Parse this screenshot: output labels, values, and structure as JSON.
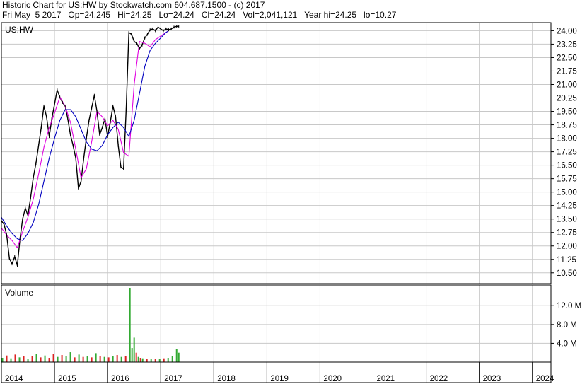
{
  "header": {
    "line1": "Historic Chart for US:HW by Stockwatch.com 604.687.1500 - (c) 2017",
    "line2": "Fri May  5 2017   Op=24.245   Hi=24.25   Lo=24.24   Cl=24.24   Vol=2,041,121   Year hi=24.25   lo=10.27"
  },
  "colors": {
    "price": "#000000",
    "ma_short": "#e000e0",
    "ma_long": "#0000c0",
    "vol_up": "#33aa33",
    "vol_down": "#dd2222",
    "grid": "#c8c8c8",
    "frame": "#000000"
  },
  "chart_data": [
    {
      "type": "line",
      "ticker_label": "US:HW",
      "ylim": [
        9.9,
        24.45
      ],
      "y_ticks": [
        "24.00",
        "23.25",
        "22.50",
        "21.75",
        "21.00",
        "20.25",
        "19.50",
        "18.75",
        "18.00",
        "17.25",
        "16.50",
        "15.75",
        "15.00",
        "14.25",
        "13.50",
        "12.75",
        "12.00",
        "11.25",
        "10.50"
      ],
      "y_tick_values": [
        24.0,
        23.25,
        22.5,
        21.75,
        21.0,
        20.25,
        19.5,
        18.75,
        18.0,
        17.25,
        16.5,
        15.75,
        15.0,
        14.25,
        13.5,
        12.75,
        12.0,
        11.25,
        10.5
      ],
      "x_ticks": [
        "2014",
        "2015",
        "2016",
        "2017",
        "2018",
        "2019",
        "2020",
        "2021",
        "2022",
        "2023",
        "2024"
      ],
      "x_tick_values": [
        2014.0,
        2015.0,
        2016.0,
        2017.0,
        2018.0,
        2019.0,
        2020.0,
        2021.0,
        2022.0,
        2023.0,
        2024.0
      ],
      "xlim": [
        2014.0,
        2024.35
      ],
      "grid": true,
      "series": [
        {
          "x": [
            2014.0,
            2014.05,
            2014.1,
            2014.15,
            2014.2,
            2014.25,
            2014.3,
            2014.35,
            2014.4,
            2014.45,
            2014.5,
            2014.55,
            2014.6,
            2014.65,
            2014.7,
            2014.75,
            2014.8,
            2014.85,
            2014.9,
            2014.95,
            2015.0,
            2015.05,
            2015.1,
            2015.15,
            2015.2,
            2015.25,
            2015.3,
            2015.35,
            2015.4,
            2015.45,
            2015.5,
            2015.55,
            2015.6,
            2015.65,
            2015.7,
            2015.75,
            2015.8,
            2015.85,
            2015.9,
            2015.95,
            2016.0,
            2016.05,
            2016.1,
            2016.15,
            2016.2,
            2016.25,
            2016.3,
            2016.35,
            2016.4,
            2016.45,
            2016.5,
            2016.55,
            2016.6,
            2016.65,
            2016.7,
            2016.75,
            2016.8,
            2016.85,
            2016.9,
            2016.95,
            2017.0,
            2017.05,
            2017.1,
            2017.15,
            2017.2,
            2017.25,
            2017.3,
            2017.34
          ],
          "values": [
            13.4,
            13.2,
            12.6,
            11.3,
            11.0,
            11.4,
            10.9,
            12.4,
            13.5,
            14.1,
            13.7,
            14.7,
            15.8,
            16.6,
            17.6,
            18.6,
            19.8,
            19.2,
            18.1,
            19.1,
            19.9,
            20.7,
            20.3,
            20.0,
            19.8,
            19.1,
            18.2,
            17.6,
            16.9,
            15.2,
            15.6,
            16.9,
            18.0,
            19.0,
            19.7,
            20.4,
            19.5,
            18.2,
            18.6,
            19.1,
            18.1,
            18.9,
            19.8,
            19.2,
            17.6,
            16.4,
            16.3,
            19.6,
            23.9,
            23.8,
            23.4,
            23.3,
            23.0,
            23.2,
            23.6,
            23.8,
            24.05,
            24.1,
            24.0,
            24.2,
            24.1,
            24.0,
            24.1,
            24.05,
            24.1,
            24.2,
            24.24,
            24.24
          ]
        },
        {
          "x": [
            2014.0,
            2014.1,
            2014.2,
            2014.3,
            2014.4,
            2014.5,
            2014.6,
            2014.7,
            2014.8,
            2014.9,
            2015.0,
            2015.1,
            2015.2,
            2015.3,
            2015.4,
            2015.5,
            2015.6,
            2015.7,
            2015.8,
            2015.9,
            2016.0,
            2016.1,
            2016.2,
            2016.3,
            2016.4,
            2016.5,
            2016.6,
            2016.7,
            2016.8,
            2016.9,
            2017.0,
            2017.1,
            2017.15
          ],
          "values": [
            13.0,
            12.6,
            12.3,
            11.9,
            12.8,
            13.6,
            14.6,
            16.0,
            17.5,
            18.6,
            19.4,
            20.3,
            19.8,
            18.9,
            17.4,
            15.8,
            16.3,
            17.8,
            19.5,
            19.2,
            18.7,
            19.0,
            18.5,
            17.2,
            17.0,
            21.0,
            23.4,
            23.3,
            23.1,
            23.5,
            23.7,
            23.9,
            24.0
          ]
        },
        {
          "x": [
            2014.0,
            2014.1,
            2014.2,
            2014.3,
            2014.4,
            2014.5,
            2014.6,
            2014.7,
            2014.8,
            2014.9,
            2015.0,
            2015.1,
            2015.2,
            2015.3,
            2015.4,
            2015.5,
            2015.6,
            2015.7,
            2015.8,
            2015.9,
            2016.0,
            2016.1,
            2016.2,
            2016.3,
            2016.4,
            2016.5,
            2016.6,
            2016.7,
            2016.8,
            2016.9,
            2017.0,
            2017.1,
            2017.15
          ],
          "values": [
            13.6,
            13.1,
            12.7,
            12.4,
            12.3,
            12.7,
            13.3,
            14.3,
            15.6,
            16.9,
            18.0,
            19.0,
            19.6,
            19.6,
            19.2,
            18.5,
            17.8,
            17.4,
            17.3,
            17.6,
            18.2,
            18.6,
            18.9,
            18.6,
            18.1,
            19.0,
            20.5,
            22.0,
            22.9,
            23.3,
            23.6,
            23.9,
            24.0
          ]
        }
      ]
    },
    {
      "type": "bar",
      "title": "Volume",
      "y_ticks": [
        "12.0 M",
        "8.0 M",
        "4.0 M"
      ],
      "y_tick_values": [
        12.0,
        8.0,
        4.0
      ],
      "ylim": [
        0,
        16.4
      ],
      "series": [
        {
          "x": [
            2014.02,
            2014.1,
            2014.18,
            2014.26,
            2014.34,
            2014.42,
            2014.5,
            2014.58,
            2014.66,
            2014.74,
            2014.82,
            2014.9,
            2014.98,
            2015.06,
            2015.14,
            2015.22,
            2015.3,
            2015.38,
            2015.46,
            2015.54,
            2015.62,
            2015.7,
            2015.78,
            2015.86,
            2015.94,
            2016.02,
            2016.1,
            2016.18,
            2016.26,
            2016.34,
            2016.42,
            2016.46,
            2016.5,
            2016.54,
            2016.58,
            2016.62,
            2016.66,
            2016.74,
            2016.82,
            2016.9,
            2016.98,
            2017.06,
            2017.14,
            2017.22,
            2017.3,
            2017.34
          ],
          "values": [
            0.9,
            1.4,
            0.8,
            1.6,
            1.0,
            1.2,
            0.7,
            1.3,
            1.7,
            1.0,
            1.4,
            0.9,
            1.8,
            1.1,
            1.5,
            1.3,
            2.1,
            1.0,
            1.6,
            1.1,
            1.2,
            1.0,
            1.9,
            1.3,
            1.1,
            1.0,
            1.2,
            1.5,
            1.1,
            1.3,
            15.8,
            3.0,
            5.2,
            2.0,
            1.1,
            0.9,
            0.8,
            0.7,
            0.6,
            0.7,
            0.6,
            0.8,
            0.9,
            1.3,
            2.8,
            2.0
          ],
          "up": [
            true,
            false,
            true,
            false,
            true,
            false,
            true,
            false,
            true,
            false,
            true,
            false,
            false,
            true,
            false,
            true,
            true,
            false,
            true,
            false,
            true,
            false,
            true,
            false,
            true,
            false,
            true,
            false,
            true,
            false,
            true,
            true,
            true,
            false,
            true,
            false,
            true,
            false,
            true,
            false,
            true,
            false,
            true,
            true,
            true,
            true
          ]
        }
      ]
    }
  ]
}
